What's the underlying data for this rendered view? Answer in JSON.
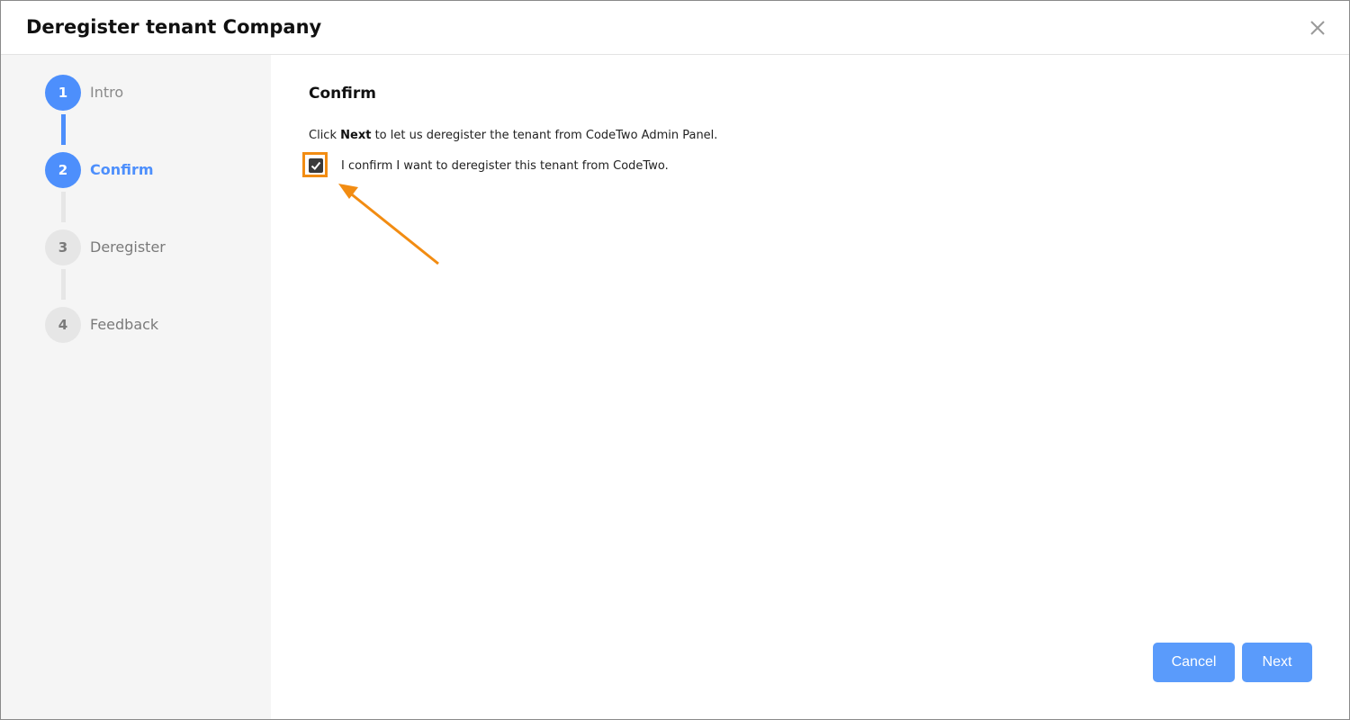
{
  "dialog": {
    "title": "Deregister tenant Company",
    "close_icon": "close-icon"
  },
  "steps": [
    {
      "number": "1",
      "label": "Intro",
      "state": "done"
    },
    {
      "number": "2",
      "label": "Confirm",
      "state": "current"
    },
    {
      "number": "3",
      "label": "Deregister",
      "state": "todo"
    },
    {
      "number": "4",
      "label": "Feedback",
      "state": "todo"
    }
  ],
  "content": {
    "section_title": "Confirm",
    "instruction_prefix": "Click",
    "instruction_bold": "Next",
    "instruction_suffix": "to let us deregister the tenant from CodeTwo Admin Panel.",
    "checkbox_label": "I confirm I want to deregister this tenant from CodeTwo.",
    "checkbox_checked": true
  },
  "buttons": {
    "cancel": "Cancel",
    "next": "Next"
  },
  "colors": {
    "accent": "#4d8ffc",
    "button": "#5a9bfb",
    "highlight": "#f28c12",
    "inactive_step": "#e6e6e6"
  }
}
